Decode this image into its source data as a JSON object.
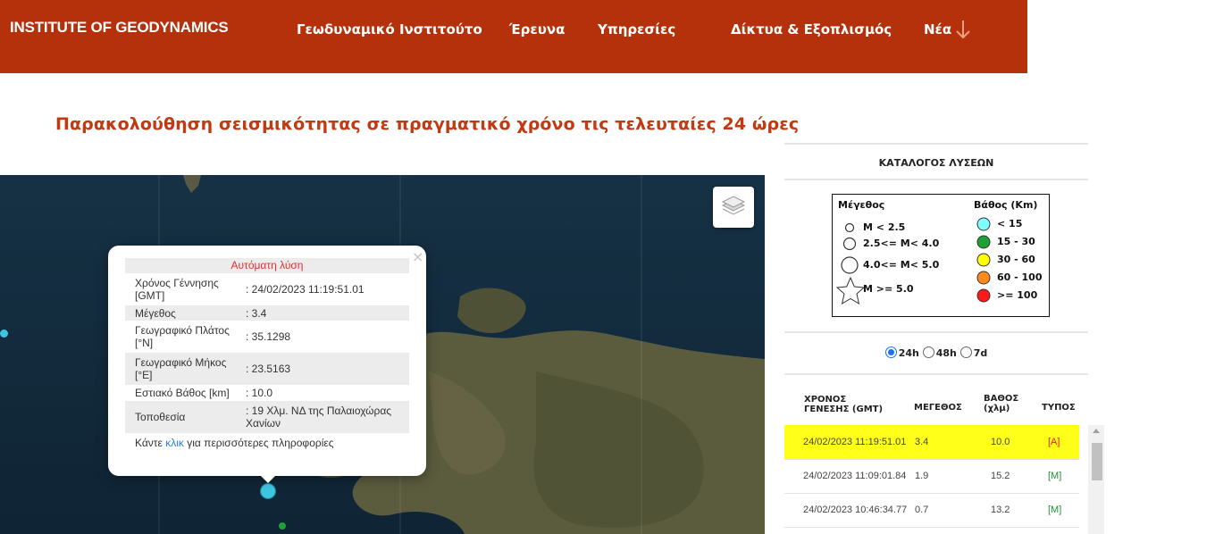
{
  "header": {
    "brand": "INSTITUTE OF GEODYNAMICS",
    "nav": [
      "Γεωδυναμικό Ινστιτούτο",
      "Έρευνα",
      "Υπηρεσίες",
      "Δίκτυα & Εξοπλισμός",
      "Νέα"
    ],
    "arrow_icon": "arrow-down-icon"
  },
  "page_title": "Παρακολούθηση σεισμικότητας σε πραγματικό χρόνο τις τελευταίες 24 ώρες",
  "map": {
    "layers_icon": "layers-icon",
    "popup": {
      "heading": "Αυτόματη λύση",
      "rows": [
        {
          "label": "Χρόνος Γέννησης [GMT]",
          "value": ": 24/02/2023 11:19:51.01"
        },
        {
          "label": "Μέγεθος",
          "value": ": 3.4"
        },
        {
          "label": "Γεωγραφικό Πλάτος [°N]",
          "value": ": 35.1298"
        },
        {
          "label": "Γεωγραφικό Μήκος [°E]",
          "value": ": 23.5163"
        },
        {
          "label": "Εστιακό Βάθος [km]",
          "value": ": 10.0"
        },
        {
          "label": "Τοποθεσία",
          "value": ": 19 Χλμ. ΝΔ της Παλαιοχώρας Χανίων"
        }
      ],
      "footer_pre": "Κάντε ",
      "footer_link": "κλικ",
      "footer_post": " για περισσότερες πληροφορίες",
      "close": "×"
    }
  },
  "panel": {
    "title": "ΚΑΤΑΛΟΓΟΣ ΛΥΣΕΩΝ",
    "legend": {
      "magnitude_title": "Μέγεθος",
      "depth_title": "Βάθος (Km)",
      "magnitudes": [
        "M < 2.5",
        "2.5<= M< 4.0",
        "4.0<= M< 5.0",
        "M >= 5.0"
      ],
      "depths": [
        "< 15",
        "15 - 30",
        "30 - 60",
        "60 - 100",
        ">= 100"
      ],
      "depth_colors": [
        "#7fffff",
        "#1fa035",
        "#ffff00",
        "#ff8c1a",
        "#ff1a1a"
      ]
    },
    "periods": [
      "24h",
      "48h",
      "7d"
    ],
    "selected_period": "24h",
    "columns": {
      "time": [
        "ΧΡΟΝΟΣ",
        "ΓΕΝΕΣΗΣ (GMT)"
      ],
      "mag": "ΜΕΓΕΘΟΣ",
      "depth": [
        "ΒΑΘΟΣ",
        "(χλμ)"
      ],
      "type": "ΤΥΠΟΣ"
    },
    "rows": [
      {
        "time": "24/02/2023 11:19:51.01",
        "mag": "3.4",
        "depth": "10.0",
        "type": "[A]"
      },
      {
        "time": "24/02/2023 11:09:01.84",
        "mag": "1.9",
        "depth": "15.2",
        "type": "[M]"
      },
      {
        "time": "24/02/2023 10:46:34.77",
        "mag": "0.7",
        "depth": "13.2",
        "type": "[M]"
      }
    ]
  }
}
